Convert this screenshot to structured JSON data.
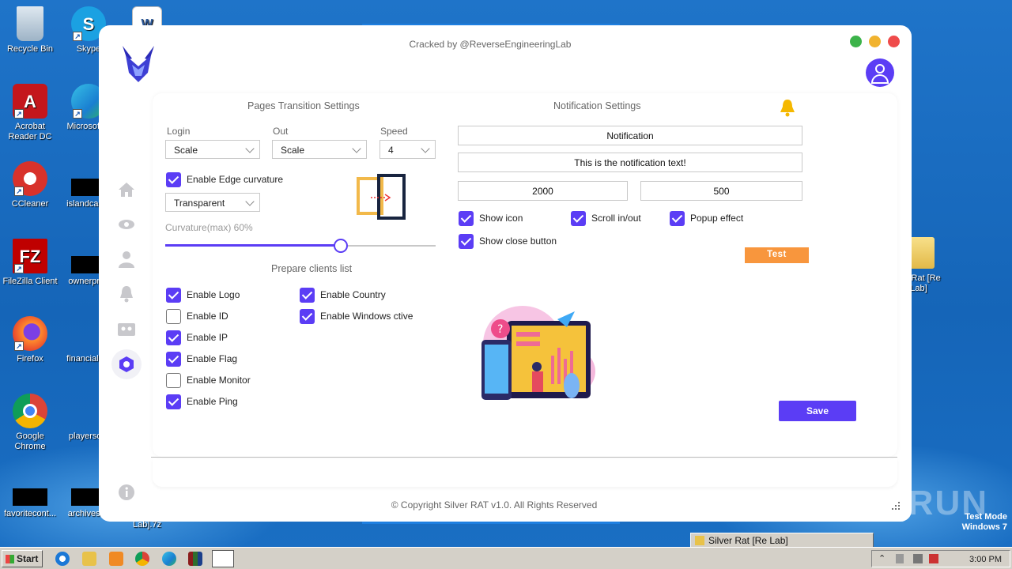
{
  "desktop": {
    "icons": [
      {
        "label": "Recycle Bin"
      },
      {
        "label": "Skype"
      },
      {
        "label": "Acrobat Reader DC"
      },
      {
        "label": "Microsoft E"
      },
      {
        "label": "CCleaner"
      },
      {
        "label": "islandcard.j"
      },
      {
        "label": "FileZilla Client"
      },
      {
        "label": "ownerpres"
      },
      {
        "label": "Firefox"
      },
      {
        "label": "financialhot"
      },
      {
        "label": "Google Chrome"
      },
      {
        "label": "playersdie"
      },
      {
        "label": "favoritecont..."
      },
      {
        "label": "archivesflo"
      },
      {
        "label": "ver Rat [Re Lab]"
      },
      {
        "label": "Lab].7z"
      }
    ],
    "watermark": "ANY RUN",
    "test_mode": "Test Mode",
    "test_mode_os": "Windows 7"
  },
  "app": {
    "title": "Cracked by @ReverseEngineeringLab",
    "copyright": "© Copyright Silver RAT v1.0. All Rights Reserved",
    "pages_transition": {
      "title": "Pages Transition Settings",
      "login_label": "Login",
      "login_value": "Scale",
      "out_label": "Out",
      "out_value": "Scale",
      "speed_label": "Speed",
      "speed_value": "4",
      "edge_curvature_label": "Enable Edge curvature",
      "edge_curvature_checked": true,
      "background_value": "Transparent",
      "curvature_label": "Curvature(max) 60%",
      "curvature_fraction": 0.65
    },
    "prepare_clients": {
      "title": "Prepare clients list",
      "options": [
        {
          "label": "Enable Logo",
          "checked": true
        },
        {
          "label": "Enable ID",
          "checked": false
        },
        {
          "label": "Enable IP",
          "checked": true
        },
        {
          "label": "Enable Flag",
          "checked": true
        },
        {
          "label": "Enable Monitor",
          "checked": false
        },
        {
          "label": "Enable Ping",
          "checked": true
        },
        {
          "label": "Enable Country",
          "checked": true
        },
        {
          "label": "Enable Windows ctive",
          "checked": true
        }
      ]
    },
    "notification": {
      "title": "Notification Settings",
      "title_value": "Notification",
      "text_value": "This is the notification text!",
      "duration_value": "2000",
      "delay_value": "500",
      "options": [
        {
          "label": "Show icon",
          "checked": true
        },
        {
          "label": "Scroll in/out",
          "checked": true
        },
        {
          "label": "Popup effect",
          "checked": true
        },
        {
          "label": "Show close button",
          "checked": true
        }
      ],
      "test_label": "Test"
    },
    "save_label": "Save",
    "colors": {
      "accent": "#5b3df5",
      "orange": "#f8963d"
    }
  },
  "taskbar": {
    "start_label": "Start",
    "window_label": "Silver Rat [Re Lab]",
    "clock": "3:00 PM"
  }
}
